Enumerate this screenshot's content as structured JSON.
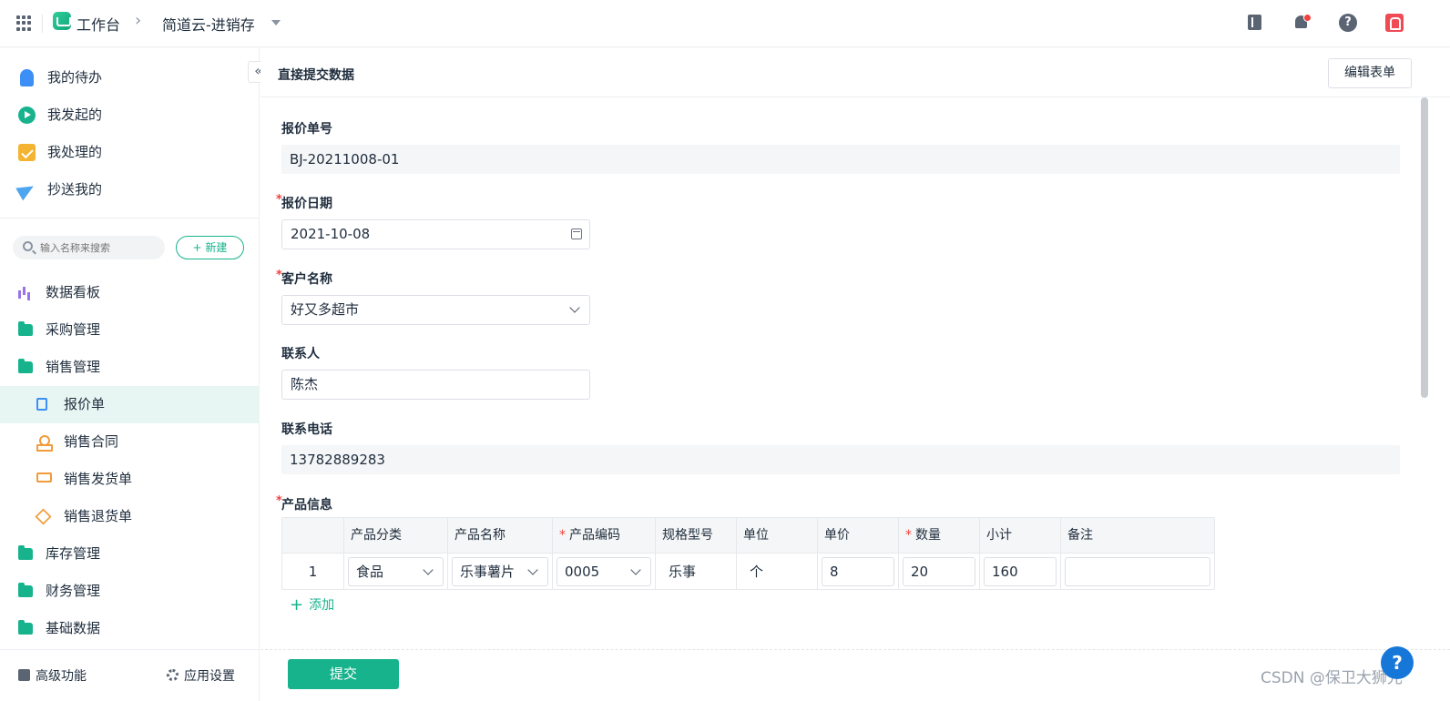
{
  "topbar": {
    "home_label": "工作台",
    "app_name": "简道云-进销存",
    "icons": [
      "apps-grid-icon",
      "book-icon",
      "notification-bell-icon",
      "help-icon",
      "avatar-icon"
    ]
  },
  "sidebar": {
    "personal": [
      {
        "label": "我的待办",
        "icon": "bell-icon"
      },
      {
        "label": "我发起的",
        "icon": "play-icon"
      },
      {
        "label": "我处理的",
        "icon": "check-box-icon"
      },
      {
        "label": "抄送我的",
        "icon": "paper-plane-icon"
      }
    ],
    "search_placeholder": "输入名称来搜索",
    "new_label": "新建",
    "tree": [
      {
        "label": "数据看板",
        "icon": "bar-chart-icon",
        "level": 0
      },
      {
        "label": "采购管理",
        "icon": "folder-icon",
        "level": 0
      },
      {
        "label": "销售管理",
        "icon": "folder-icon",
        "level": 0
      },
      {
        "label": "报价单",
        "icon": "document-icon",
        "level": 1,
        "active": true
      },
      {
        "label": "销售合同",
        "icon": "seal-icon",
        "level": 1
      },
      {
        "label": "销售发货单",
        "icon": "truck-icon",
        "level": 1
      },
      {
        "label": "销售退货单",
        "icon": "box-icon",
        "level": 1
      },
      {
        "label": "库存管理",
        "icon": "folder-icon",
        "level": 0
      },
      {
        "label": "财务管理",
        "icon": "folder-icon",
        "level": 0
      },
      {
        "label": "基础数据",
        "icon": "folder-icon",
        "level": 0
      }
    ],
    "footer": {
      "advanced": "高级功能",
      "settings": "应用设置"
    }
  },
  "form": {
    "title": "直接提交数据",
    "edit_button": "编辑表单",
    "quote_no": {
      "label": "报价单号",
      "value": "BJ-20211008-01"
    },
    "quote_date": {
      "label": "报价日期",
      "value": "2021-10-08",
      "required": "*"
    },
    "customer": {
      "label": "客户名称",
      "value": "好又多超市",
      "required": "*"
    },
    "contact": {
      "label": "联系人",
      "value": "陈杰"
    },
    "phone": {
      "label": "联系电话",
      "value": "13782889283"
    },
    "products": {
      "label": "产品信息",
      "required": "*",
      "columns": [
        "",
        "产品分类",
        "产品名称",
        "产品编码",
        "规格型号",
        "单位",
        "单价",
        "数量",
        "小计",
        "备注"
      ],
      "required_mark": "*",
      "rows": [
        {
          "index": "1",
          "category": "食品",
          "name": "乐事薯片",
          "code": "0005",
          "spec": "乐事",
          "unit": "个",
          "price": "8",
          "qty": "20",
          "subtotal": "160",
          "note": ""
        }
      ],
      "add_label": "添加"
    },
    "submit_label": "提交"
  },
  "watermark": "CSDN @保卫大狮兄",
  "colors": {
    "accent": "#17b38c",
    "required": "#f0413e",
    "help_fab": "#1677d9"
  }
}
